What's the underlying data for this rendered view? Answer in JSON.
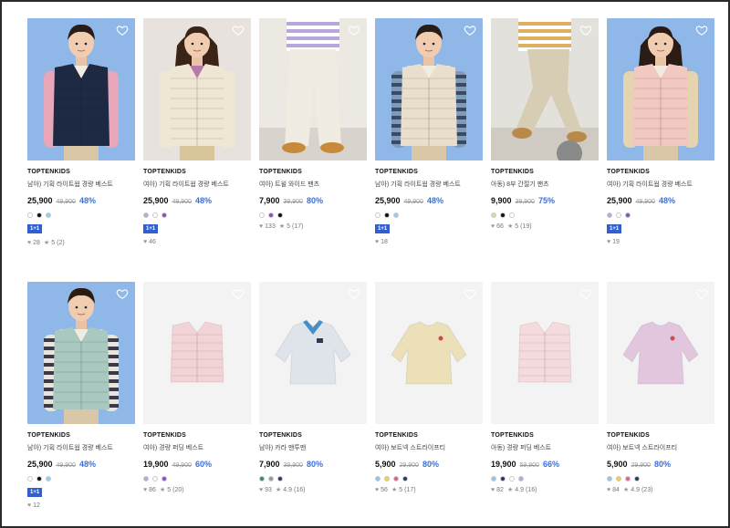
{
  "products": [
    {
      "brand": "TOPTENKIDS",
      "name": "남아) 기획 라이트웜 경량 베스트",
      "price": "25,900",
      "original": "49,900",
      "discount": "48%",
      "swatches": [
        "#ffffff",
        "#111111",
        "#8fd0ee"
      ],
      "badge": "1+1",
      "likes": "28",
      "rating": "5",
      "reviews": "(2)",
      "thumb": "photo-boy-navy-vest"
    },
    {
      "brand": "TOPTENKIDS",
      "name": "여아) 기획 라이트웜 경량 베스트",
      "price": "25,900",
      "original": "49,900",
      "discount": "48%",
      "swatches": [
        "#b9a6dc",
        "#ffffff",
        "#8a4fc0"
      ],
      "badge": "1+1",
      "likes": "46",
      "rating": "",
      "reviews": "",
      "thumb": "photo-girl-ivory-vest"
    },
    {
      "brand": "TOPTENKIDS",
      "name": "여아) 트윌 와이드 팬츠",
      "price": "7,900",
      "original": "39,900",
      "discount": "80%",
      "swatches": [
        "#ffffff",
        "#8a4fc0",
        "#111111"
      ],
      "badge": "",
      "likes": "133",
      "rating": "5",
      "reviews": "(17)",
      "thumb": "photo-wide-pants"
    },
    {
      "brand": "TOPTENKIDS",
      "name": "남아) 기획 라이트웜 경량 베스트",
      "price": "25,900",
      "original": "49,900",
      "discount": "48%",
      "swatches": [
        "#ffffff",
        "#111111",
        "#8fd0ee"
      ],
      "badge": "1+1",
      "likes": "18",
      "rating": "",
      "reviews": "",
      "thumb": "photo-boy-ivory-vest"
    },
    {
      "brand": "TOPTENKIDS",
      "name": "아동) 8부 간절기 팬츠",
      "price": "9,900",
      "original": "39,900",
      "discount": "75%",
      "swatches": [
        "#d8dca0",
        "#111111",
        "#ffffff"
      ],
      "badge": "",
      "likes": "66",
      "rating": "5",
      "reviews": "(19)",
      "thumb": "photo-beige-pants"
    },
    {
      "brand": "TOPTENKIDS",
      "name": "여아) 기획 라이트웜 경량 베스트",
      "price": "25,900",
      "original": "49,900",
      "discount": "48%",
      "swatches": [
        "#b9a6dc",
        "#ffffff",
        "#8a4fc0"
      ],
      "badge": "1+1",
      "likes": "19",
      "rating": "",
      "reviews": "",
      "thumb": "photo-girl-pink-vest"
    },
    {
      "brand": "TOPTENKIDS",
      "name": "남아) 기획 라이트웜 경량 베스트",
      "price": "25,900",
      "original": "49,900",
      "discount": "48%",
      "swatches": [
        "#ffffff",
        "#111111",
        "#8fd0ee"
      ],
      "badge": "1+1",
      "likes": "12",
      "rating": "",
      "reviews": "",
      "thumb": "photo-boy-mint-vest"
    },
    {
      "brand": "TOPTENKIDS",
      "name": "여아) 경량 퍼딩 베스트",
      "price": "19,900",
      "original": "49,900",
      "discount": "60%",
      "swatches": [
        "#b9a6dc",
        "#ffffff",
        "#8a4fc0"
      ],
      "badge": "",
      "likes": "86",
      "rating": "5",
      "reviews": "(20)",
      "thumb": "flat-pink-vest"
    },
    {
      "brand": "TOPTENKIDS",
      "name": "남아) 카라 맨투맨",
      "price": "7,900",
      "original": "39,900",
      "discount": "80%",
      "swatches": [
        "#3a8a5a",
        "#9a9a9a",
        "#2a3a5a"
      ],
      "badge": "",
      "likes": "93",
      "rating": "4.9",
      "reviews": "(16)",
      "thumb": "flat-collar-sweatshirt"
    },
    {
      "brand": "TOPTENKIDS",
      "name": "여아) 보트넥 스트라이프티",
      "price": "5,900",
      "original": "29,900",
      "discount": "80%",
      "swatches": [
        "#8fc6ee",
        "#f0d040",
        "#e0608a",
        "#2a3a5a"
      ],
      "badge": "",
      "likes": "56",
      "rating": "5",
      "reviews": "(17)",
      "thumb": "flat-yellow-tee"
    },
    {
      "brand": "TOPTENKIDS",
      "name": "아동) 경량 퍼딩 베스트",
      "price": "19,900",
      "original": "59,900",
      "discount": "66%",
      "swatches": [
        "#8fc6ee",
        "#2a3a5a",
        "#ffffff",
        "#b9a6dc"
      ],
      "badge": "",
      "likes": "82",
      "rating": "4.9",
      "reviews": "(16)",
      "thumb": "flat-light-pink-vest"
    },
    {
      "brand": "TOPTENKIDS",
      "name": "여아) 보트넥 스트라이프티",
      "price": "5,900",
      "original": "29,900",
      "discount": "80%",
      "swatches": [
        "#8fc6ee",
        "#f0d040",
        "#e0608a",
        "#2a3a5a"
      ],
      "badge": "",
      "likes": "84",
      "rating": "4.9",
      "reviews": "(23)",
      "thumb": "flat-lavender-tee"
    }
  ],
  "icons": {
    "wishlist": "heart-outline-icon",
    "likes": "heart-icon",
    "rating": "star-icon"
  }
}
